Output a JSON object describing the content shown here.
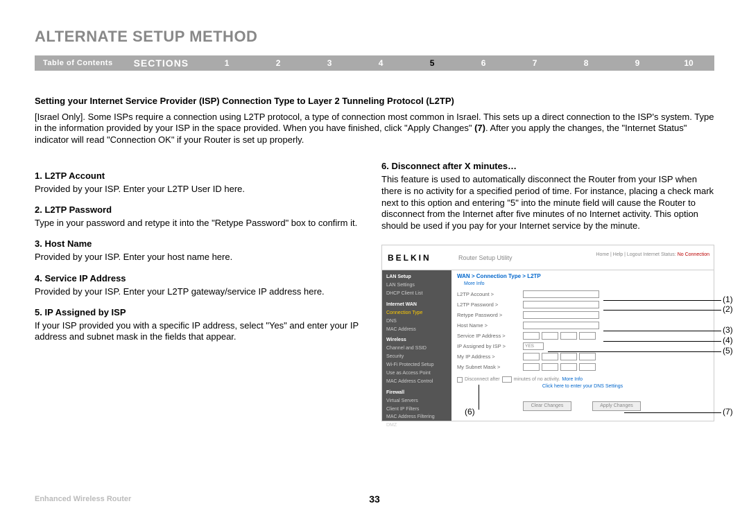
{
  "title": "ALTERNATE SETUP METHOD",
  "nav": {
    "toc": "Table of Contents",
    "label": "SECTIONS",
    "pages": [
      "1",
      "2",
      "3",
      "4",
      "5",
      "6",
      "7",
      "8",
      "9",
      "10"
    ],
    "active": "5"
  },
  "intro": {
    "head": "Setting your Internet Service Provider (ISP) Connection Type to Layer 2 Tunneling Protocol (L2TP)",
    "body_a": "[Israel Only]. Some ISPs require a connection using L2TP protocol, a type of connection most common in Israel. This sets up a direct connection to the ISP's system. Type in the information provided by your ISP in the space provided. When you have finished, click \"Apply Changes\" ",
    "body_bold": "(7)",
    "body_b": ". After you apply the changes, the \"Internet Status\" indicator will read \"Connection OK\" if your Router is set up properly."
  },
  "items": [
    {
      "head": "1. L2TP Account",
      "body": "Provided by your ISP. Enter your L2TP User ID here."
    },
    {
      "head": "2. L2TP Password",
      "body": "Type in your password and retype it into the \"Retype Password\" box to confirm it."
    },
    {
      "head": "3. Host Name",
      "body": "Provided by your ISP. Enter your host name here."
    },
    {
      "head": "4. Service IP Address",
      "body": "Provided by your ISP. Enter your L2TP gateway/service IP address here."
    },
    {
      "head": "5.  IP Assigned by ISP",
      "body": "If your ISP provided you with a specific IP address, select \"Yes\" and enter your IP address and subnet mask in the fields that appear."
    }
  ],
  "right_item": {
    "head": "6. Disconnect after X minutes…",
    "body": "This feature is used to automatically disconnect the Router from your ISP when there is no activity for a specified period of time. For instance, placing a check mark next to this option and entering \"5\" into the minute field will cause the Router to disconnect from the Internet after five minutes of no Internet activity. This option should be used if you pay for your Internet service by the minute."
  },
  "shot": {
    "logo": "BELKIN",
    "util": "Router Setup Utility",
    "topright_a": "Home | Help | Logout  Internet Status: ",
    "topright_b": "No Connection",
    "side": {
      "lan": "LAN Setup",
      "lan1": "LAN Settings",
      "lan2": "DHCP Client List",
      "wan": "Internet WAN",
      "wan1": "Connection Type",
      "wan2": "DNS",
      "wan3": "MAC Address",
      "wl": "Wireless",
      "wl1": "Channel and SSID",
      "wl2": "Security",
      "wl3": "Wi-Fi Protected Setup",
      "wl4": "Use as Access Point",
      "wl5": "MAC Address Control",
      "fw": "Firewall",
      "fw1": "Virtual Servers",
      "fw2": "Client IP Filters",
      "fw3": "MAC Address Filtering",
      "fw4": "DMZ"
    },
    "main": {
      "crumb": "WAN > Connection Type > L2TP",
      "more": "More Info",
      "rows": {
        "r1": "L2TP Account >",
        "r2": "L2TP Password >",
        "r3": "Retype Password >",
        "r4": "Host Name >",
        "r5": "Service IP Address >",
        "r6": "IP Assigned by ISP >",
        "r6v": "YES",
        "r7": "My IP Address >",
        "r8": "My Subnet Mask >"
      },
      "disc_a": "Disconnect after",
      "disc_b": "minutes of no activity.",
      "disc_mi": "More Info",
      "dns": "Click here to enter your DNS Settings",
      "btn1": "Clear Changes",
      "btn2": "Apply Changes"
    }
  },
  "callouts": {
    "c1": "(1)",
    "c2": "(2)",
    "c3": "(3)",
    "c4": "(4)",
    "c5": "(5)",
    "c6": "(6)",
    "c7": "(7)"
  },
  "footer": {
    "product": "Enhanced Wireless Router",
    "page": "33"
  }
}
